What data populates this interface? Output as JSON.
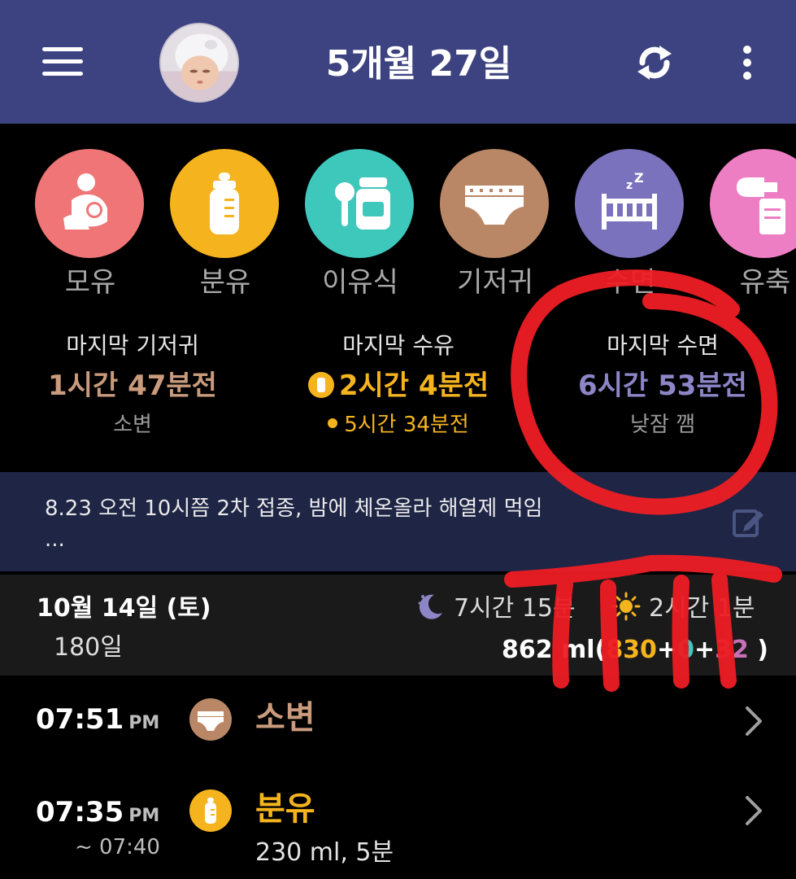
{
  "header": {
    "title": "5개월 27일"
  },
  "categories": [
    {
      "label": "모유",
      "color": "#ef7576",
      "icon": "breastfeeding-icon"
    },
    {
      "label": "분유",
      "color": "#f5b41e",
      "icon": "bottle-icon"
    },
    {
      "label": "이유식",
      "color": "#3ec8bc",
      "icon": "baby-food-icon"
    },
    {
      "label": "기저귀",
      "color": "#b98766",
      "icon": "diaper-icon"
    },
    {
      "label": "수면",
      "color": "#7b72bd",
      "icon": "crib-icon"
    },
    {
      "label": "유축",
      "color": "#ee7ec4",
      "icon": "breast-pump-icon"
    }
  ],
  "summary": {
    "diaper": {
      "title": "마지막 기저귀",
      "value": "1시간 47분전",
      "sub": "소변",
      "color": "#c99b7c"
    },
    "feeding": {
      "title": "마지막 수유",
      "value": "2시간 4분전",
      "sub": "5시간 34분전",
      "color": "#f5b41e"
    },
    "sleep": {
      "title": "마지막 수면",
      "value": "6시간 53분전",
      "sub": "낮잠 깸",
      "color": "#8c86c7"
    }
  },
  "memo": {
    "text": "8.23 오전 10시쯤 2차 접종, 밤에 체온올라 해열제 먹임",
    "more": "..."
  },
  "day": {
    "date": "10월 14일 (토)",
    "age": "180일",
    "night_sleep": "7시간 15분",
    "day_sleep": "2시간 1분",
    "total": "862 ml",
    "formula": "830",
    "food": "0",
    "pumped": "32"
  },
  "timeline": [
    {
      "time": "07:51",
      "ampm": "PM",
      "name": "소변",
      "name_color": "#c99b7c",
      "icon": "diaper-icon"
    },
    {
      "time": "07:35",
      "ampm": "PM",
      "until": "~ 07:40",
      "name": "분유",
      "name_color": "#f5b41e",
      "detail": "230 ml, 5분",
      "icon": "bottle-icon"
    }
  ],
  "annotation_color": "#ee1d24"
}
